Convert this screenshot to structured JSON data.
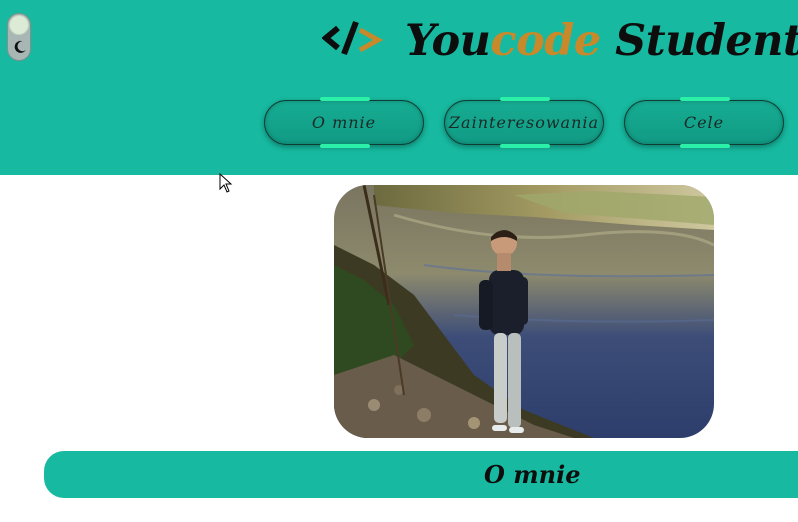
{
  "header": {
    "brand": {
      "part1": "You",
      "accent": "code",
      "part2": " Student"
    },
    "logo_icon": "code-slash-icon",
    "theme_toggle": {
      "icon": "moon-icon"
    },
    "nav": [
      {
        "label": "O mnie"
      },
      {
        "label": "Zainteresowania"
      },
      {
        "label": "Cele"
      }
    ]
  },
  "main": {
    "photo": {
      "description": "person-by-river-photo"
    },
    "section_title": "O mnie"
  },
  "colors": {
    "header_bg": "#17b9a0",
    "brand_accent": "#c7892a",
    "button_glow": "#2bf0a8"
  }
}
